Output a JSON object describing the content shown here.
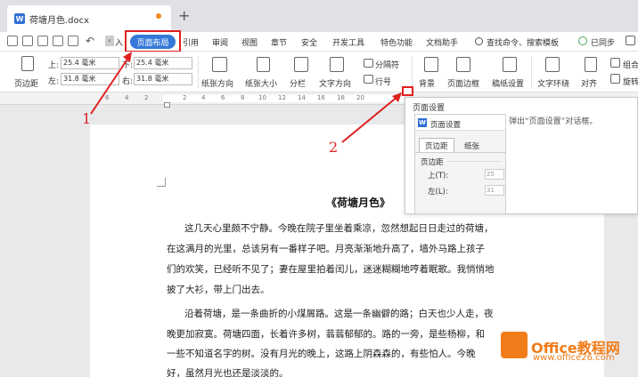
{
  "tab": {
    "title": "荷塘月色.docx",
    "icon": "W"
  },
  "menu": {
    "insert": "入",
    "page_layout": "页面布局",
    "items": [
      "引用",
      "审阅",
      "视图",
      "章节",
      "安全",
      "开发工具",
      "特色功能",
      "文档助手"
    ],
    "search": "查找命令、搜索模板",
    "sync": "已同步"
  },
  "ribbon": {
    "margins": "页边距",
    "top_label": "上:",
    "top_value": "25.4 毫米",
    "bottom_label": "下:",
    "bottom_value": "25.4 毫米",
    "left_label": "左:",
    "left_value": "31.8 毫米",
    "right_label": "右:",
    "right_value": "31.8 毫米",
    "orientation": "纸张方向",
    "size": "纸张大小",
    "columns": "分栏",
    "text_direction": "文字方向",
    "breaks": "分隔符",
    "line_numbers": "行号",
    "background": "背景",
    "page_border": "页面边框",
    "paper_settings": "稿纸设置",
    "text_wrap": "文字环绕",
    "align": "对齐",
    "group": "组合",
    "rotate": "旋转"
  },
  "ruler": {
    "marks": [
      "6",
      "4",
      "2",
      "2",
      "4",
      "6",
      "8",
      "10",
      "12",
      "14",
      "16",
      "18",
      "20"
    ]
  },
  "tooltip": {
    "title": "页面设置",
    "thumb_title": "页面设置",
    "thumb_tab_margins": "页边距",
    "thumb_tab_paper": "纸张",
    "thumb_section": "页边距",
    "thumb_top": "上(T):",
    "thumb_left": "左(L):",
    "thumb_top_value": "25",
    "thumb_left_value": "31",
    "desc": "弹出“页面设置”对话框。"
  },
  "document": {
    "heading": "《荷塘月色》",
    "lines": [
      "这几天心里颇不宁静。今晚在院子里坐着乘凉，忽然想起日日走过的荷塘，",
      "在这满月的光里，总该另有一番样子吧。月亮渐渐地升高了，墙外马路上孩子",
      "们的欢笑，已经听不见了；妻在屋里拍着闰儿，迷迷糊糊地哼着眠歌。我悄悄地",
      "披了大衫，带上门出去。",
      "沿着荷塘，是一条曲折的小煤屑路。这是一条幽僻的路；白天也少人走，夜",
      "晚更加寂寞。荷塘四面，长着许多树，蓊蓊郁郁的。路的一旁，是些杨柳，和",
      "一些不知道名字的树。没有月光的晚上，这路上阴森森的，有些怕人。今晚",
      "好，虽然月光也还是淡淡的。"
    ]
  },
  "annotations": {
    "one": "1",
    "two": "2"
  },
  "watermark": {
    "name": "Office教程网",
    "url": "www.office26.com"
  },
  "colors": {
    "accent": "#3579d8",
    "annotation": "#e02020",
    "watermark": "#f07c1a"
  }
}
